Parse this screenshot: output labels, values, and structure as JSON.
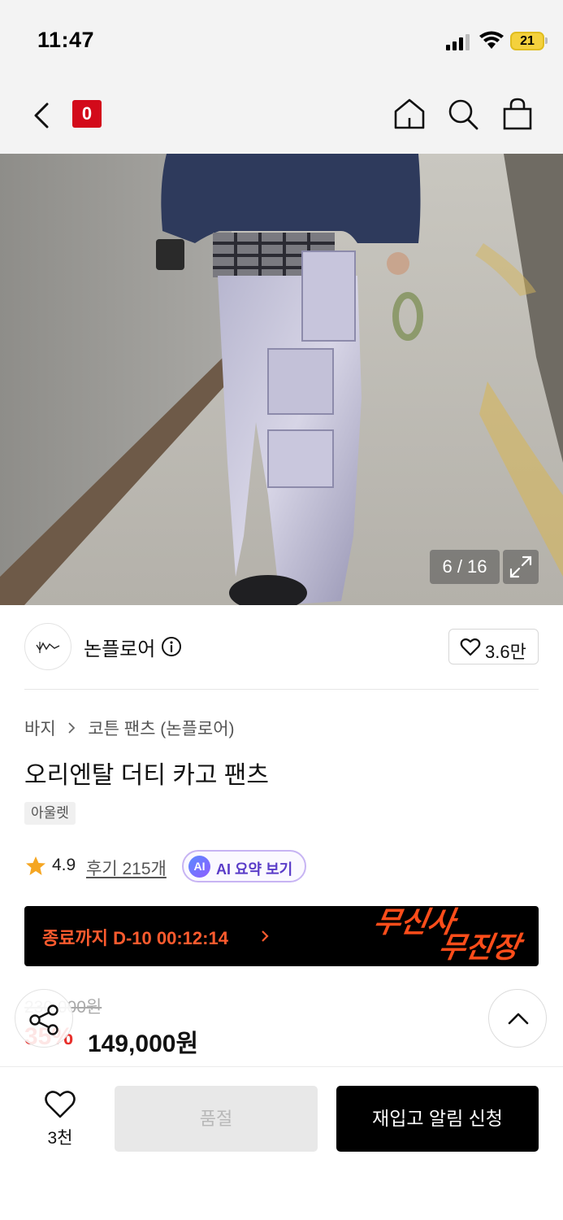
{
  "status_bar": {
    "time": "11:47",
    "battery": "21"
  },
  "nav": {
    "brand_logo": "0",
    "icons": [
      "back-icon",
      "home-icon",
      "search-icon",
      "shopping-bag-icon"
    ]
  },
  "gallery": {
    "counter": "6 / 16",
    "current_image": 6,
    "total_images": 16
  },
  "brand": {
    "name": "논플로어",
    "like_count": "3.6만"
  },
  "product": {
    "breadcrumb": [
      "바지",
      "코튼 팬츠 (논플로어)"
    ],
    "title": "오리엔탈 더티 카고 팬츠",
    "badge": "아울렛",
    "rating": "4.9",
    "review_label": "후기 215개",
    "ai_badge": "AI",
    "ai_label": "AI 요약 보기"
  },
  "event_banner": {
    "timer": "종료까지 D-10 00:12:14",
    "logo_line1": "무신사",
    "logo_line2": "무진장",
    "accent_color": "#ff5b2e"
  },
  "price": {
    "original": "230,000원",
    "discount": "35%",
    "final": "149,000원",
    "discount_color": "#e8302c"
  },
  "bottom_bar": {
    "like_count": "3천",
    "soldout_label": "품절",
    "restock_label": "재입고 알림 신청"
  }
}
